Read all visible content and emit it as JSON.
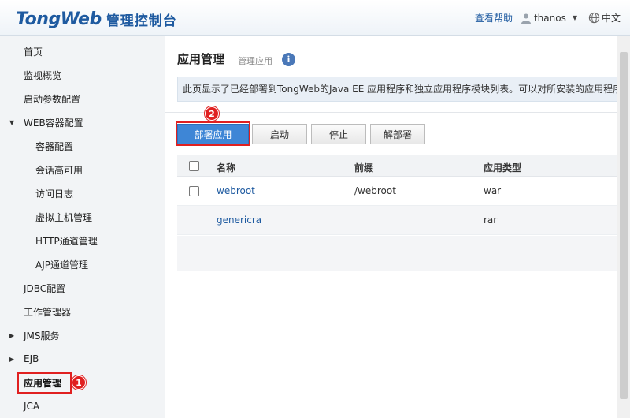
{
  "header": {
    "logo_brand": "TongWeb",
    "logo_title": "管理控制台",
    "help": "查看帮助",
    "username": "thanos",
    "language": "中文"
  },
  "sidebar": {
    "items": [
      {
        "label": "首页"
      },
      {
        "label": "监视概览"
      },
      {
        "label": "启动参数配置"
      },
      {
        "label": "WEB容器配置",
        "expanded": true
      },
      {
        "label": "容器配置"
      },
      {
        "label": "会话高可用"
      },
      {
        "label": "访问日志"
      },
      {
        "label": "虚拟主机管理"
      },
      {
        "label": "HTTP通道管理"
      },
      {
        "label": "AJP通道管理"
      },
      {
        "label": "JDBC配置"
      },
      {
        "label": "工作管理器"
      },
      {
        "label": "JMS服务",
        "expanded": false
      },
      {
        "label": "EJB",
        "expanded": false
      },
      {
        "label": "应用管理",
        "active": true
      },
      {
        "label": "JCA"
      }
    ],
    "badge": "1"
  },
  "main": {
    "title": "应用管理",
    "subtitle": "管理应用",
    "info_icon": "i",
    "description": "此页显示了已经部署到TongWeb的Java EE 应用程序和独立应用程序模块列表。可以对所安装的应用程序",
    "buttons": {
      "deploy": "部署应用",
      "start": "启动",
      "stop": "停止",
      "undeploy": "解部署"
    },
    "deploy_badge": "2",
    "table": {
      "headers": [
        "名称",
        "前缀",
        "应用类型"
      ],
      "rows": [
        {
          "name": "webroot",
          "prefix": "/webroot",
          "type": "war"
        },
        {
          "name": "genericra",
          "prefix": "",
          "type": "rar"
        }
      ]
    }
  },
  "colors": {
    "accent": "#1e5aa0",
    "primary_button": "#3e86d6",
    "highlight": "#e02020"
  }
}
